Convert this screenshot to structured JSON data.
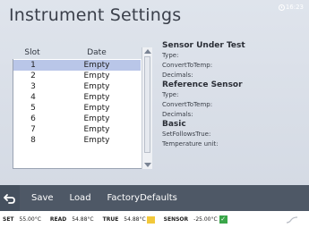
{
  "header": {
    "title": "Instrument Settings",
    "time": "16:23"
  },
  "slots": {
    "columns": [
      "Slot",
      "Date"
    ],
    "rows": [
      {
        "slot": "1",
        "date": "Empty"
      },
      {
        "slot": "2",
        "date": "Empty"
      },
      {
        "slot": "3",
        "date": "Empty"
      },
      {
        "slot": "4",
        "date": "Empty"
      },
      {
        "slot": "5",
        "date": "Empty"
      },
      {
        "slot": "6",
        "date": "Empty"
      },
      {
        "slot": "7",
        "date": "Empty"
      },
      {
        "slot": "8",
        "date": "Empty"
      }
    ],
    "selected_index": 0
  },
  "info": {
    "sensor_under_test": {
      "heading": "Sensor Under Test",
      "type": "Type:",
      "convert": "ConvertToTemp:",
      "decimals": "Decimals:"
    },
    "reference_sensor": {
      "heading": "Reference Sensor",
      "type": "Type:",
      "convert": "ConvertToTemp:",
      "decimals": "Decimals:"
    },
    "basic": {
      "heading": "Basic",
      "set_follows_true": "SetFollowsTrue:",
      "temperature_unit": "Temperature unit:"
    }
  },
  "toolbar": {
    "back_icon": "back-arrow-icon",
    "save": "Save",
    "load": "Load",
    "factory_defaults": "FactoryDefaults"
  },
  "status": {
    "set_label": "SET",
    "set_value": "55.00°C",
    "read_label": "READ",
    "read_value": "54.88°C",
    "true_label": "TRUE",
    "true_value": "54.88°C",
    "sensor_label": "SENSOR",
    "sensor_value": "-25.00°C",
    "true_indicator_color": "#f2c83a",
    "sensor_indicator_color": "#3aa64a"
  }
}
